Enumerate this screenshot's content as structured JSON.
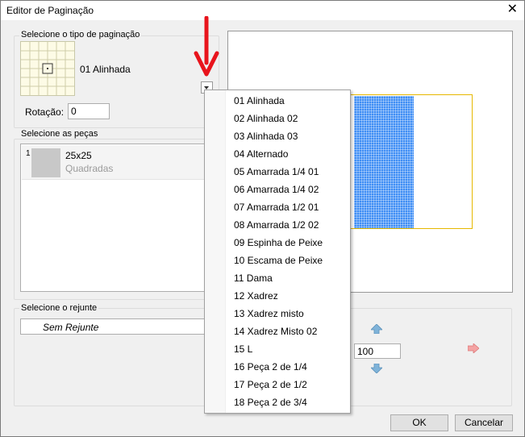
{
  "window": {
    "title": "Editor de Paginação"
  },
  "pagination": {
    "group_label": "Selecione o tipo de paginação",
    "selected": "01 Alinhada",
    "rotation_label": "Rotação:",
    "rotation_value": "0"
  },
  "pieces": {
    "group_label": "Selecione as peças",
    "items": [
      {
        "index": "1",
        "name": "25x25",
        "subtitle": "Quadradas"
      }
    ]
  },
  "grout": {
    "group_label": "Selecione o rejunte",
    "selected": "Sem Rejunte"
  },
  "controls": {
    "size_value": "100"
  },
  "dropdown": {
    "options": [
      "01 Alinhada",
      "02 Alinhada 02",
      "03 Alinhada 03",
      "04 Alternado",
      "05 Amarrada 1/4 01",
      "06 Amarrada 1/4 02",
      "07 Amarrada 1/2 01",
      "08 Amarrada 1/2 02",
      "09 Espinha de Peixe",
      "10 Escama de Peixe",
      "11 Dama",
      "12 Xadrez",
      "13 Xadrez misto",
      "14 Xadrez Misto 02",
      "15 L",
      "16 Peça 2 de 1/4",
      "17 Peça 2 de 1/2",
      "18 Peça 2 de 3/4"
    ]
  },
  "buttons": {
    "ok": "OK",
    "cancel": "Cancelar"
  },
  "colors": {
    "tile_fill": "#3f8ef5",
    "plate_border": "#e6b800",
    "annotation_arrow": "#e8141c"
  }
}
